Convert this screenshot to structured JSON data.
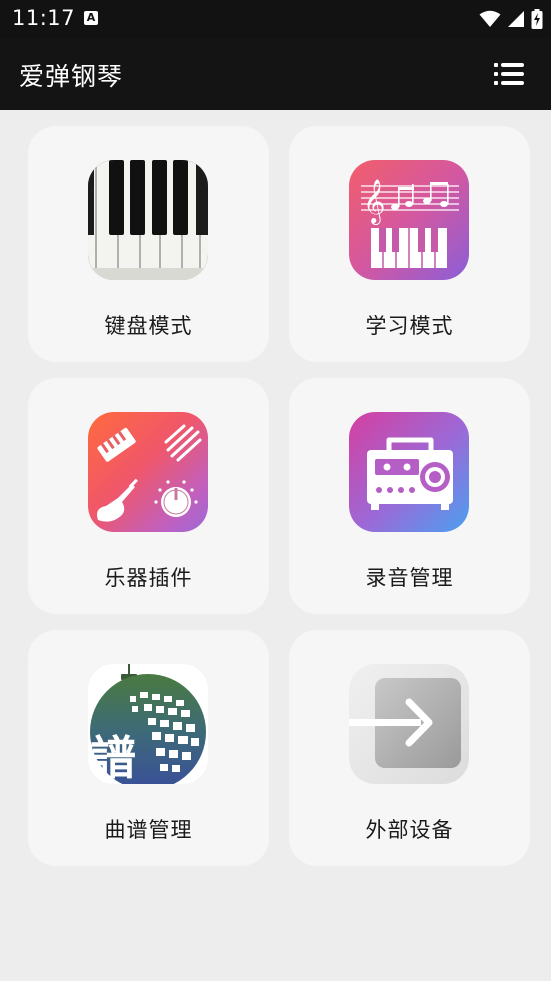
{
  "status_bar": {
    "time": "11:17",
    "notification_icon_letter": "A",
    "icons": [
      "wifi-icon",
      "cellular-signal-icon",
      "battery-charging-icon"
    ]
  },
  "app_bar": {
    "title": "爱弹钢琴",
    "menu_icon": "list-menu-icon"
  },
  "features": [
    {
      "label": "键盘模式",
      "icon": "piano-keyboard-icon"
    },
    {
      "label": "学习模式",
      "icon": "sheet-music-keyboard-icon"
    },
    {
      "label": "乐器插件",
      "icon": "instrument-plugin-icon"
    },
    {
      "label": "录音管理",
      "icon": "radio-recorder-icon"
    },
    {
      "label": "曲谱管理",
      "icon": "score-disco-ball-icon"
    },
    {
      "label": "外部设备",
      "icon": "external-device-arrow-icon"
    }
  ],
  "colors": {
    "app_bar": "#141414",
    "background": "#ededed",
    "card": "#f6f6f6"
  }
}
